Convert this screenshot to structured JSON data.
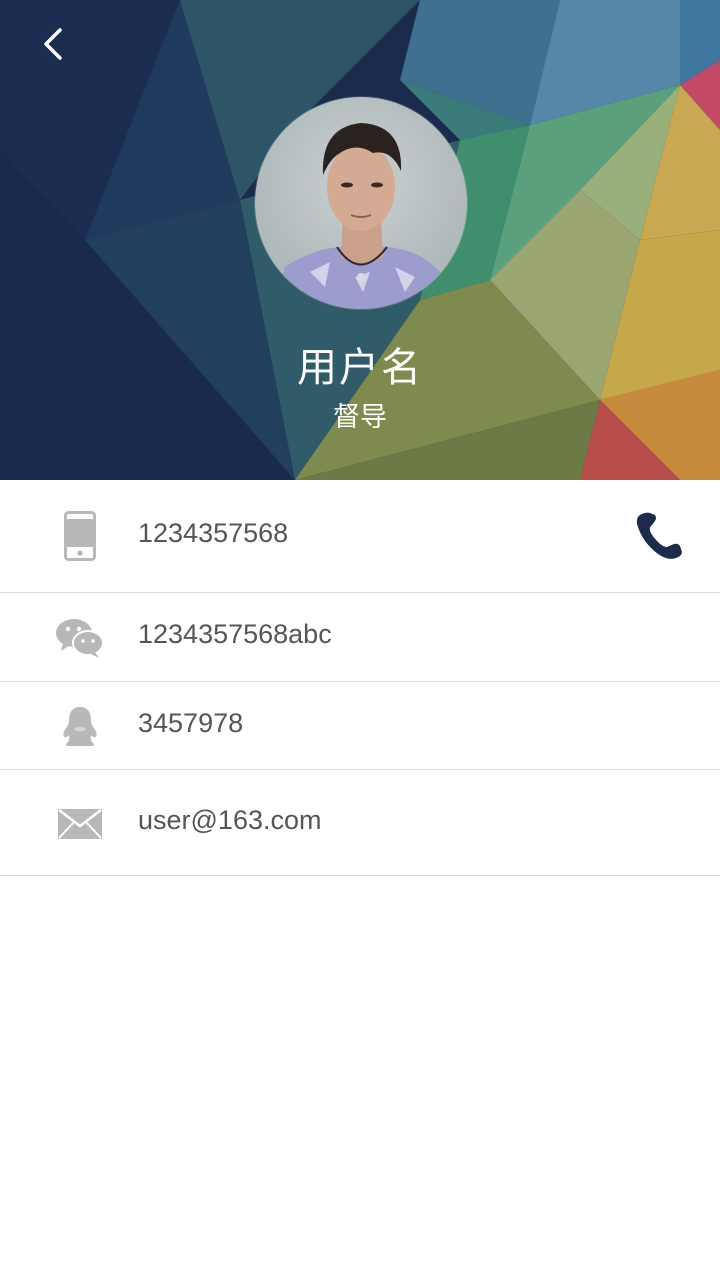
{
  "header": {
    "back_icon": "chevron-left-icon",
    "avatar_alt": "user avatar photo",
    "name": "用户名",
    "role": "督导"
  },
  "contacts": [
    {
      "type": "phone",
      "icon": "mobile-phone-icon",
      "value": "1234357568",
      "action_icon": "phone-call-icon"
    },
    {
      "type": "wechat",
      "icon": "wechat-icon",
      "value": "1234357568abc"
    },
    {
      "type": "qq",
      "icon": "qq-penguin-icon",
      "value": "3457978"
    },
    {
      "type": "email",
      "icon": "mail-envelope-icon",
      "value": "user@163.com"
    }
  ],
  "colors": {
    "icon_gray": "#b8b8b8",
    "call_icon": "#1c2a4e",
    "text_gray": "#555555",
    "divider": "#dcdcdc"
  }
}
